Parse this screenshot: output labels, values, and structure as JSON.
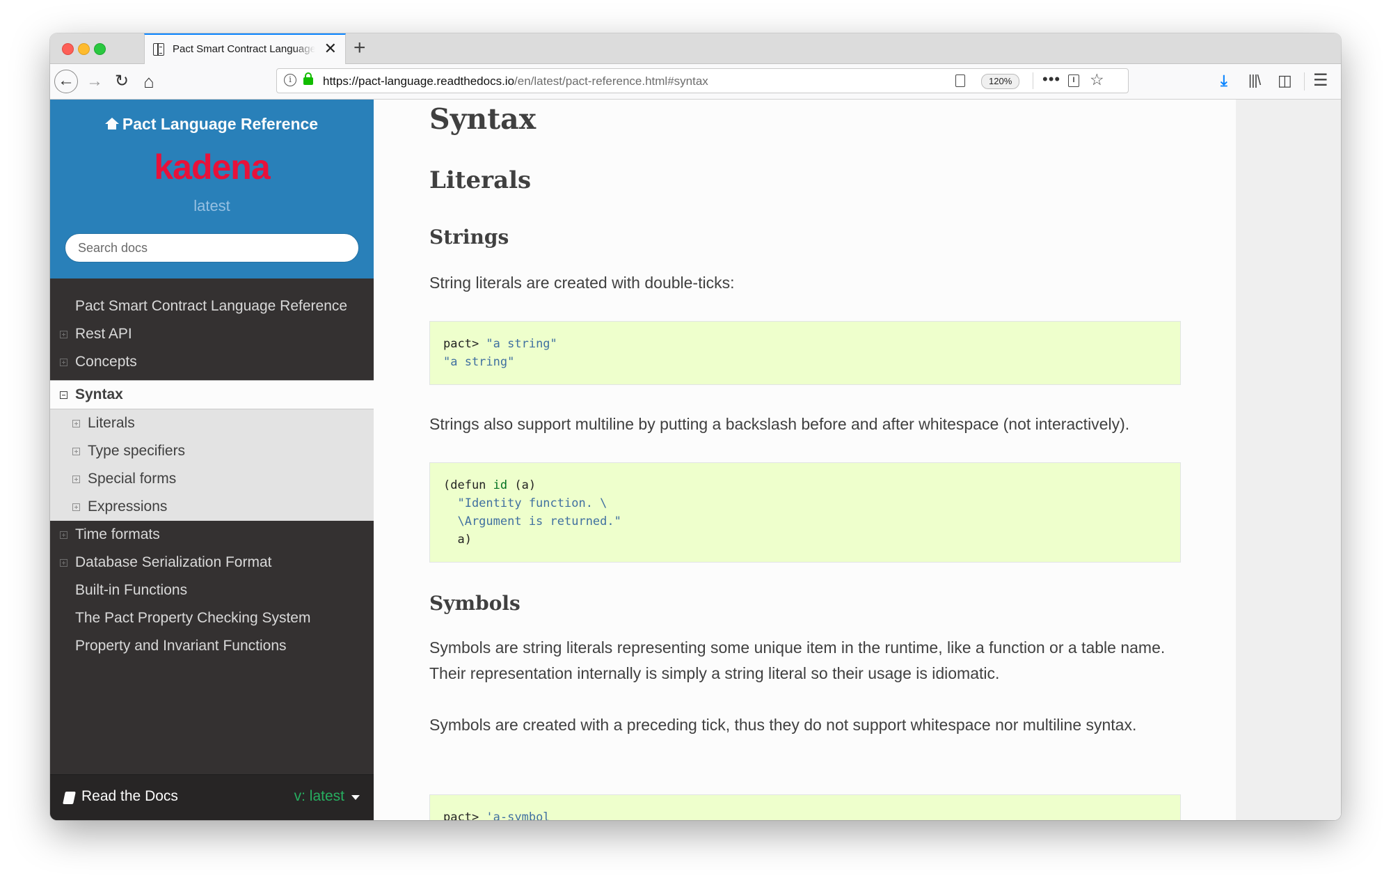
{
  "browser": {
    "tab_title": "Pact Smart Contract Language Reference",
    "tab_close": "✕",
    "new_tab": "+",
    "url_host": "https://pact-language.readthedocs.io",
    "url_path": "/en/latest/pact-reference.html#syntax",
    "zoom": "120%",
    "info_icon": "i",
    "more": "•••",
    "nav_icons": {
      "back": "←",
      "forward": "→",
      "reload": "↻",
      "home": "⌂"
    },
    "tool_icons": {
      "download": "⤓",
      "library": "|||\\",
      "sidebar": "◫",
      "menu": "☰",
      "star": "☆",
      "pocket": "I"
    }
  },
  "sidebar": {
    "project_title": "Pact Language Reference",
    "logo_text": "kadena",
    "version": "latest",
    "search_placeholder": "Search docs",
    "items": [
      {
        "label": "Pact Smart Contract Language Reference",
        "expandable": false
      },
      {
        "label": "Rest API",
        "expandable": true
      },
      {
        "label": "Concepts",
        "expandable": true
      },
      {
        "label": "Syntax",
        "expandable": true,
        "current": true
      },
      {
        "label": "Time formats",
        "expandable": true
      },
      {
        "label": "Database Serialization Format",
        "expandable": true
      },
      {
        "label": "Built-in Functions",
        "expandable": false
      },
      {
        "label": "The Pact Property Checking System",
        "expandable": false
      },
      {
        "label": "Property and Invariant Functions",
        "expandable": false
      }
    ],
    "sub_items": [
      {
        "label": "Literals"
      },
      {
        "label": "Type specifiers"
      },
      {
        "label": "Special forms"
      },
      {
        "label": "Expressions"
      }
    ],
    "footer": {
      "label": "Read the Docs",
      "version": "v: latest"
    }
  },
  "main": {
    "h1": "Syntax",
    "h2": "Literals",
    "strings_heading": "Strings",
    "strings_para1": "String literals are created with double-ticks:",
    "code1": {
      "l1_prompt": "pact> ",
      "l1_str": "\"a string\"",
      "l2_str": "\"a string\""
    },
    "strings_para2": "Strings also support multiline by putting a backslash before and after whitespace (not interactively).",
    "code2": {
      "l1_a": "(defun ",
      "l1_id": "id",
      "l1_b": " (a)",
      "l2": "  \"Identity function. \\",
      "l3": "  \\Argument is returned.\"",
      "l4": "  a)"
    },
    "symbols_heading": "Symbols",
    "symbols_para1": "Symbols are string literals representing some unique item in the runtime, like a function or a table name. Their representation internally is simply a string literal so their usage is idiomatic.",
    "symbols_para2": "Symbols are created with a preceding tick, thus they do not support whitespace nor multiline syntax.",
    "code3": {
      "l1_prompt": "pact> ",
      "l1_sym": "'a-symbol"
    }
  }
}
